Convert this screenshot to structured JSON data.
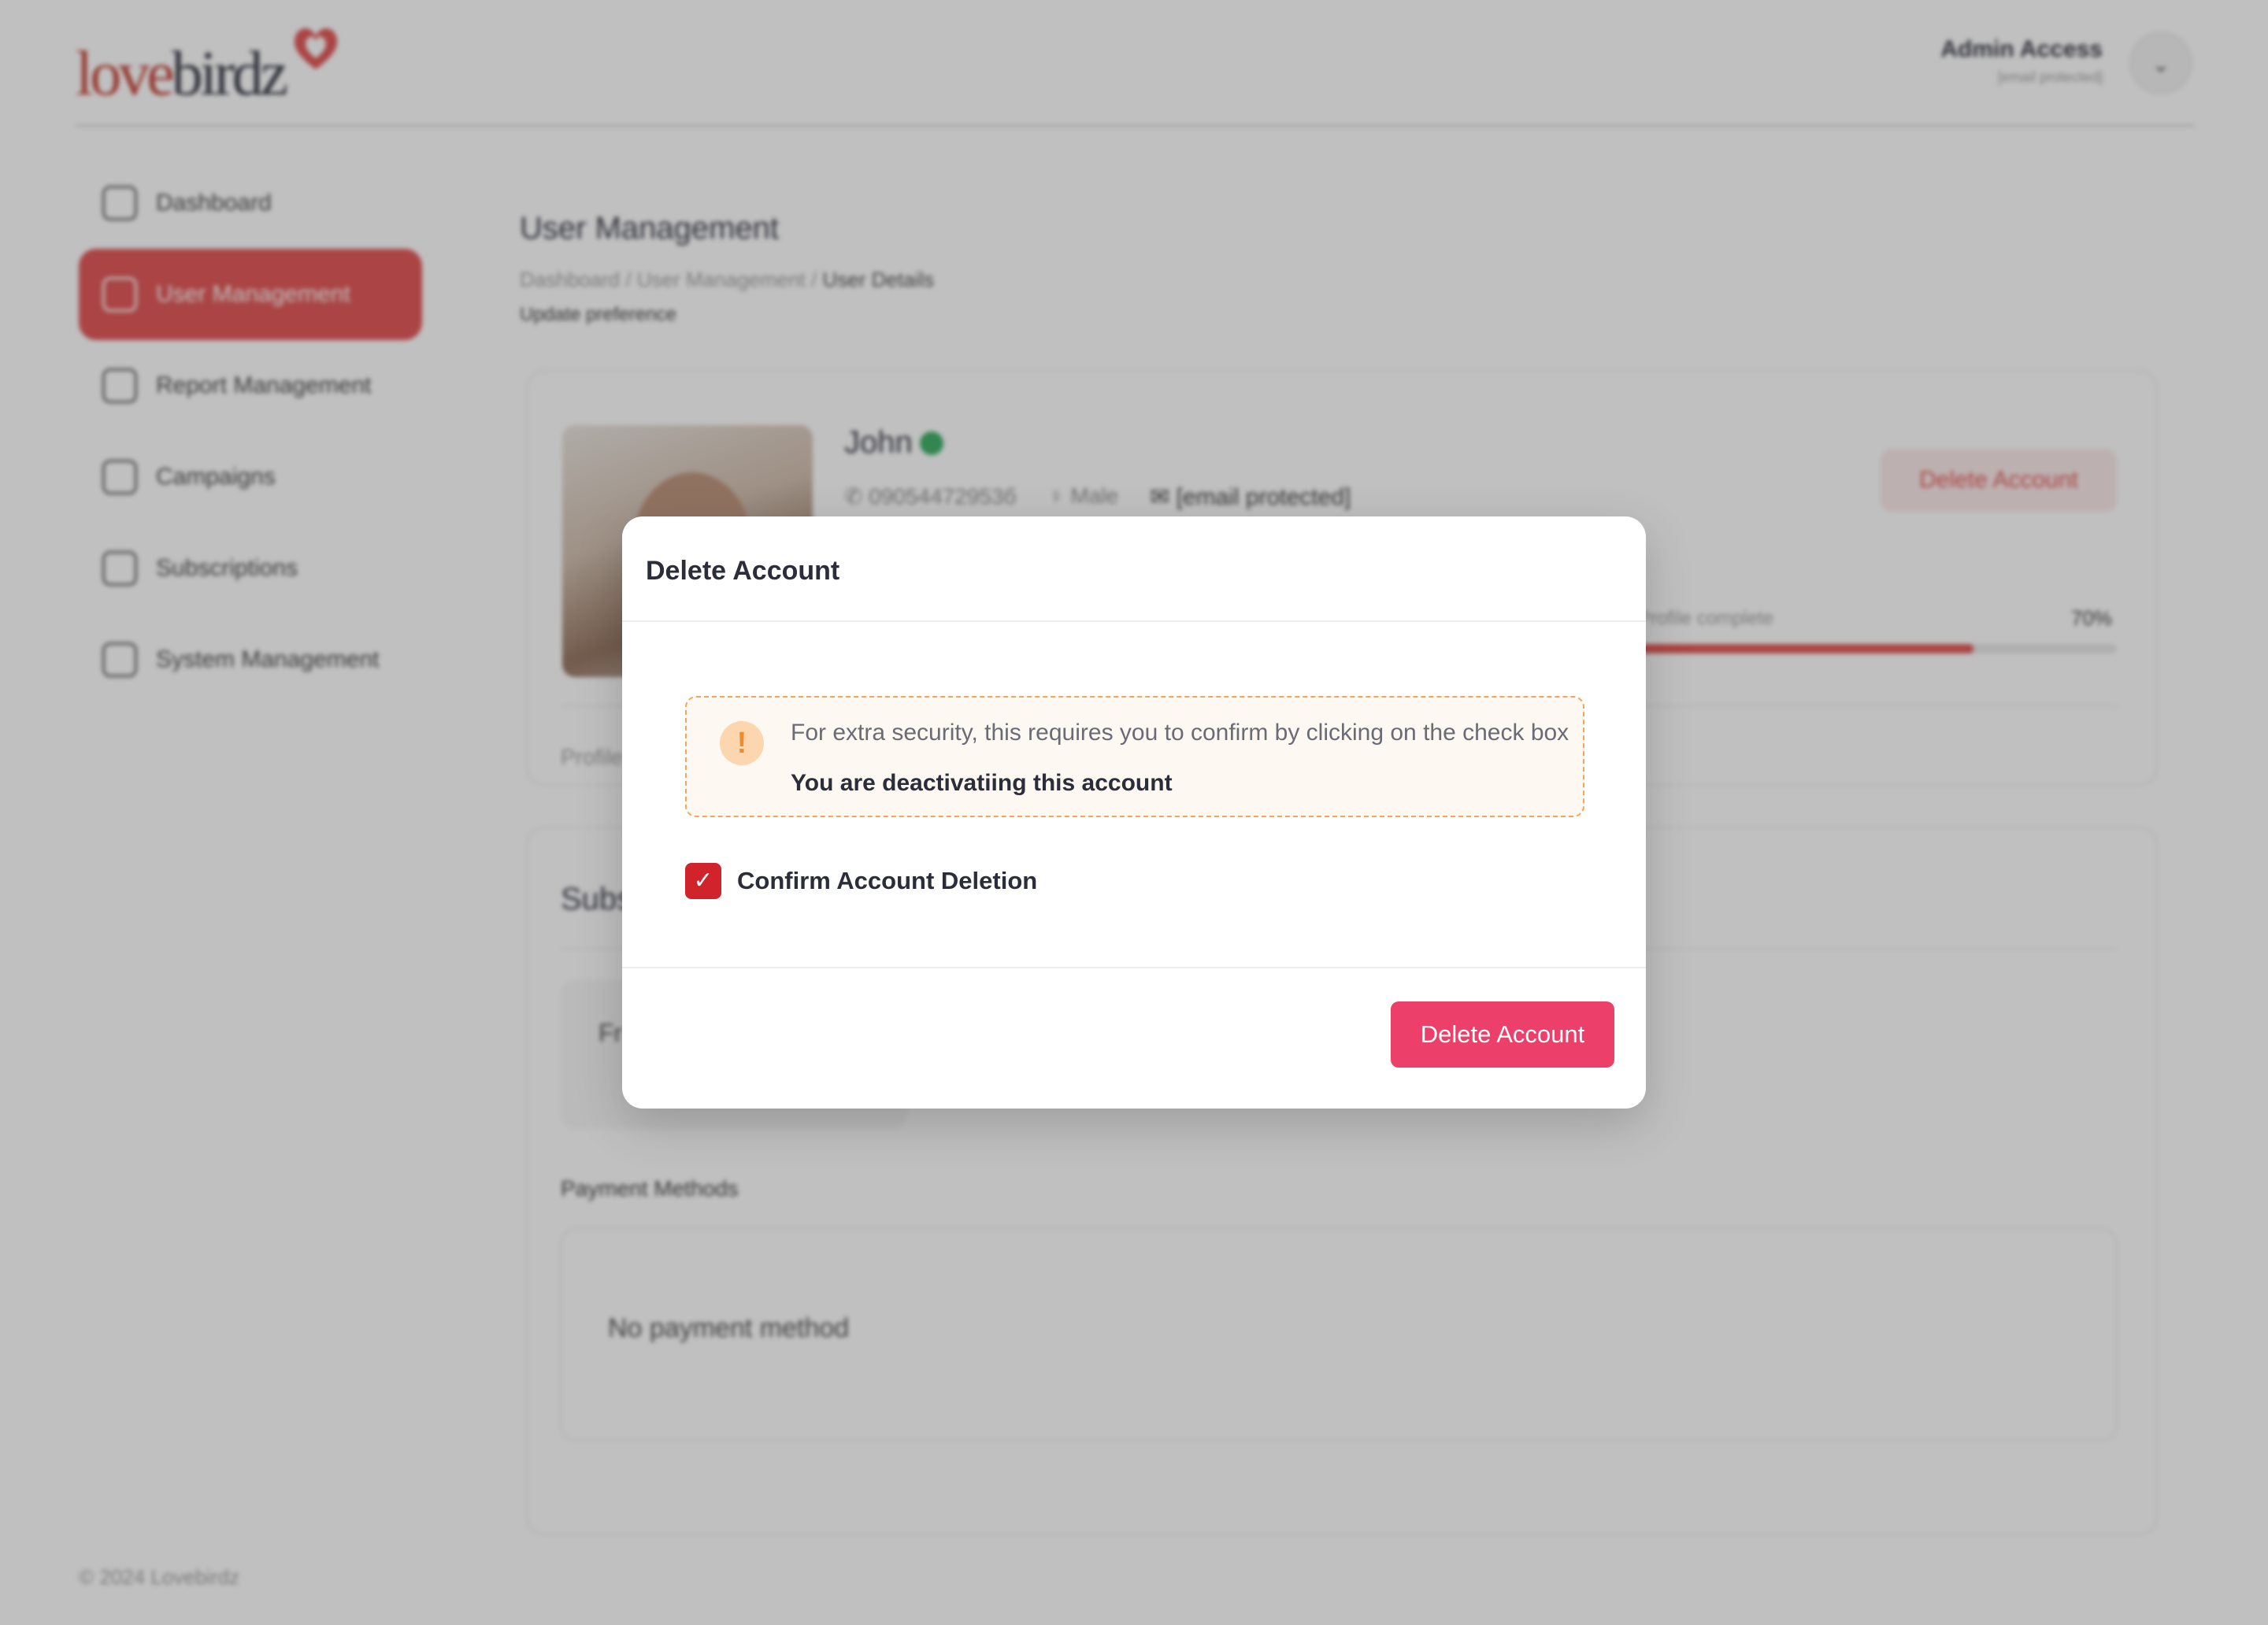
{
  "brand": {
    "logo_part1": "love",
    "logo_part2": "birdz",
    "accent": "#e04a4a"
  },
  "header": {
    "admin_name": "Admin Access",
    "admin_email": "[email protected]",
    "dropdown_icon": "chevron-down-icon"
  },
  "sidebar": {
    "items": [
      {
        "label": "Dashboard",
        "icon": "home-icon",
        "active": false
      },
      {
        "label": "User Management",
        "icon": "users-icon",
        "active": true
      },
      {
        "label": "Report Management",
        "icon": "clipboard-icon",
        "active": false
      },
      {
        "label": "Campaigns",
        "icon": "campaign-icon",
        "active": false
      },
      {
        "label": "Subscriptions",
        "icon": "subscription-icon",
        "active": false
      },
      {
        "label": "System Management",
        "icon": "settings-sliders-icon",
        "active": false
      }
    ]
  },
  "main": {
    "title": "User Management",
    "breadcrumb": [
      "Dashboard",
      "User Management",
      "User Details"
    ],
    "breadcrumb_sep": "/",
    "subtitle": "Update preference"
  },
  "profile": {
    "name": "John",
    "status": "online",
    "status_color": "#2eaa5a",
    "phone": "09054472953б",
    "gender": "Male",
    "email": "[email protected]",
    "delete_label": "Delete Account",
    "progress_label": "Profile complete",
    "progress_value": 0.7,
    "progress_text": "70%",
    "tab_label": "Profile"
  },
  "subscription": {
    "title": "Subs",
    "plan_label": "Fr",
    "payment_title": "Payment Methods",
    "no_payment": "No payment method"
  },
  "footer": {
    "text": "© 2024 Lovebirdz"
  },
  "modal": {
    "title": "Delete Account",
    "notice_icon": "!",
    "notice_text": "For extra security, this requires you to confirm by clicking on the check box",
    "notice_bold": "You are deactivatiing this account",
    "checkbox_checked": true,
    "checkbox_mark": "✓",
    "checkbox_label": "Confirm Account Deletion",
    "button_label": "Delete Account",
    "button_color": "#ec3f6a",
    "warning_color": "#f2a65a"
  }
}
